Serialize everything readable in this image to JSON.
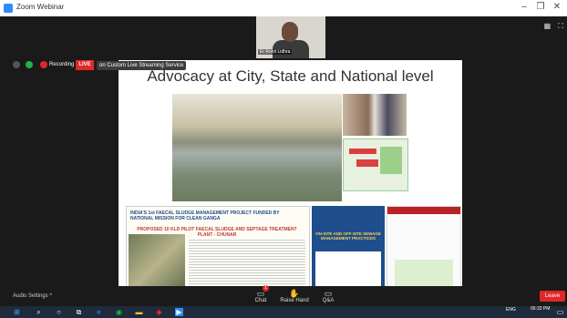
{
  "window": {
    "title": "Zoom Webinar"
  },
  "speaker": {
    "name": "Er Rohit Lidhra"
  },
  "recording": {
    "label": "Recording",
    "live": "LIVE",
    "stream_text": "on Custom Live Streaming Service"
  },
  "slide": {
    "title": "Advocacy at City, State and National level",
    "doc1_heading": "INDIA'S 1st FAECAL SLUDGE MANAGEMENT PROJECT FUNDED BY NATIONAL MISSION FOR CLEAN GANGA",
    "doc1_subheading": "PROPOSED 10 KLD PILOT FAECAL SLUDGE AND SEPTAGE TREATMENT PLANT - CHUNAR",
    "doc2_title": "ON-SITE AND OFF-SITE SEWAGE MANAGEMENT PRACTICES"
  },
  "toolbar": {
    "audio_settings": "Audio Settings",
    "chat": "Chat",
    "chat_badge": "1",
    "raise_hand": "Raise Hand",
    "qa": "Q&A",
    "leave": "Leave"
  },
  "taskbar": {
    "lang": "ENG",
    "time": "06:32 PM"
  },
  "colors": {
    "zoom_blue": "#2d8cff",
    "live_red": "#e02828"
  }
}
